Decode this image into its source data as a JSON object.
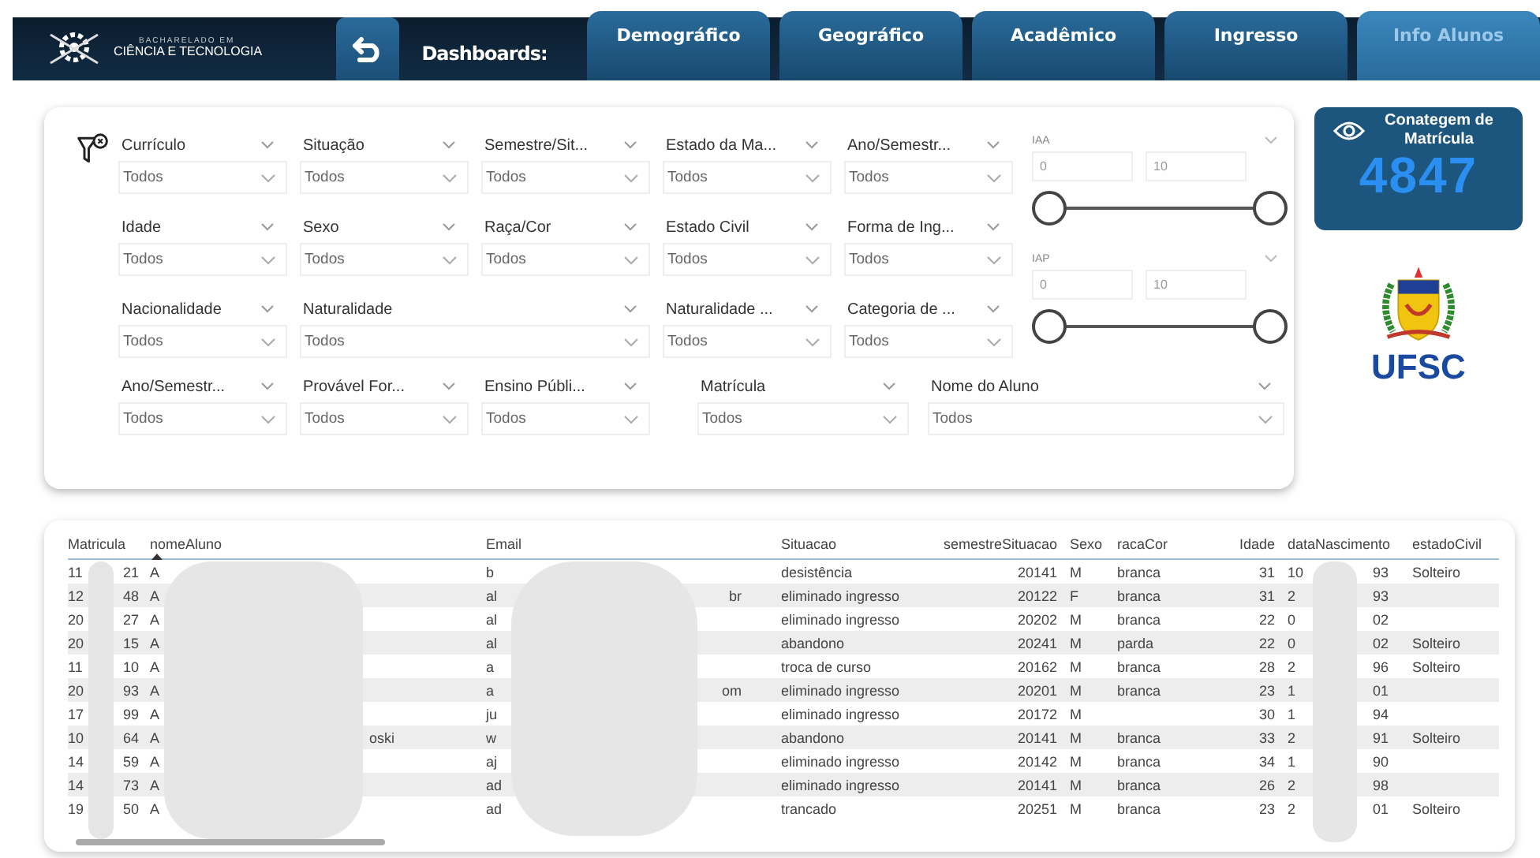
{
  "header": {
    "logo_top": "BACHARELADO EM",
    "logo_bottom": "CIÊNCIA E TECNOLOGIA",
    "nav_label": "Dashboards:",
    "tabs": [
      {
        "label": "Demográfico",
        "selected": false
      },
      {
        "label": "Geográfico",
        "selected": false
      },
      {
        "label": "Acadêmico",
        "selected": false
      },
      {
        "label": "Ingresso",
        "selected": false
      },
      {
        "label": "Info Alunos",
        "selected": true
      }
    ]
  },
  "filters": {
    "grid": [
      [
        {
          "label": "Currículo",
          "value": "Todos",
          "kind": "normal"
        },
        {
          "label": "Situação",
          "value": "Todos",
          "kind": "normal"
        },
        {
          "label": "Semestre/Sit...",
          "value": "Todos",
          "kind": "normal"
        },
        {
          "label": "Estado da Ma...",
          "value": "Todos",
          "kind": "normal"
        },
        {
          "label": "Ano/Semestr...",
          "value": "Todos",
          "kind": "normal"
        }
      ],
      [
        {
          "label": "Idade",
          "value": "Todos",
          "kind": "normal"
        },
        {
          "label": "Sexo",
          "value": "Todos",
          "kind": "normal"
        },
        {
          "label": "Raça/Cor",
          "value": "Todos",
          "kind": "normal"
        },
        {
          "label": "Estado Civil",
          "value": "Todos",
          "kind": "normal"
        },
        {
          "label": "Forma de Ing...",
          "value": "Todos",
          "kind": "normal"
        }
      ],
      [
        {
          "label": "Nacionalidade",
          "value": "Todos",
          "kind": "normal"
        },
        {
          "label": "Naturalidade",
          "value": "Todos",
          "kind": "wide"
        },
        {
          "label": "Naturalidade ...",
          "value": "Todos",
          "kind": "normal"
        },
        {
          "label": "Categoria de ...",
          "value": "Todos",
          "kind": "normal"
        }
      ]
    ],
    "bottom_row": [
      {
        "label": "Ano/Semestr...",
        "value": "Todos",
        "kind": "normal"
      },
      {
        "label": "Provável For...",
        "value": "Todos",
        "kind": "normal"
      },
      {
        "label": "Ensino Públi...",
        "value": "Todos",
        "kind": "normal"
      },
      {
        "label": "Matrícula",
        "value": "Todos",
        "kind": "medium"
      },
      {
        "label": "Nome do Aluno",
        "value": "Todos",
        "kind": "long"
      }
    ],
    "sliders": [
      {
        "label": "IAA",
        "min": "0",
        "max": "10"
      },
      {
        "label": "IAP",
        "min": "0",
        "max": "10"
      }
    ]
  },
  "card": {
    "title": "Conategem de Matrícula",
    "value": "4847"
  },
  "brand": {
    "name": "UFSC"
  },
  "table": {
    "columns": [
      "Matricula",
      "nomeAluno",
      "Email",
      "Situacao",
      "semestreSituacao",
      "Sexo",
      "racaCor",
      "Idade",
      "dataNascimento",
      "estadoCivil"
    ],
    "rows": [
      {
        "mat_start": "11",
        "mat_end": "21",
        "nome_start": "A",
        "email_start": "b",
        "situacao": "desistência",
        "semestre": "20141",
        "sexo": "M",
        "raca": "branca",
        "idade": "31",
        "nasc_start": "10",
        "nasc_end": "93",
        "estado": "Solteiro"
      },
      {
        "mat_start": "12",
        "mat_end": "48",
        "nome_start": "A",
        "email_start": "al",
        "email_end": "br",
        "situacao": "eliminado ingresso",
        "semestre": "20122",
        "sexo": "F",
        "raca": "branca",
        "idade": "31",
        "nasc_start": "2",
        "nasc_end": "93"
      },
      {
        "mat_start": "20",
        "mat_end": "27",
        "nome_start": "A",
        "email_start": "al",
        "situacao": "eliminado ingresso",
        "semestre": "20202",
        "sexo": "M",
        "raca": "branca",
        "idade": "22",
        "nasc_start": "0",
        "nasc_end": "02"
      },
      {
        "mat_start": "20",
        "mat_end": "15",
        "nome_start": "A",
        "email_start": "al",
        "situacao": "abandono",
        "semestre": "20241",
        "sexo": "M",
        "raca": "parda",
        "idade": "22",
        "nasc_start": "0",
        "nasc_end": "02",
        "estado": "Solteiro"
      },
      {
        "mat_start": "11",
        "mat_end": "10",
        "nome_start": "A",
        "email_start": "a",
        "situacao": "troca de curso",
        "semestre": "20162",
        "sexo": "M",
        "raca": "branca",
        "idade": "28",
        "nasc_start": "2",
        "nasc_end": "96",
        "estado": "Solteiro"
      },
      {
        "mat_start": "20",
        "mat_end": "93",
        "nome_start": "A",
        "email_start": "a",
        "email_end": "om",
        "situacao": "eliminado ingresso",
        "semestre": "20201",
        "sexo": "M",
        "raca": "branca",
        "idade": "23",
        "nasc_start": "1",
        "nasc_end": "01"
      },
      {
        "mat_start": "17",
        "mat_end": "99",
        "nome_start": "A",
        "email_start": "ju",
        "situacao": "eliminado ingresso",
        "semestre": "20172",
        "sexo": "M",
        "idade": "30",
        "nasc_start": "1",
        "nasc_end": "94"
      },
      {
        "mat_start": "10",
        "mat_end": "64",
        "nome_start": "A",
        "nome_end": "oski",
        "email_start": "w",
        "situacao": "abandono",
        "semestre": "20141",
        "sexo": "M",
        "raca": "branca",
        "idade": "33",
        "nasc_start": "2",
        "nasc_end": "91",
        "estado": "Solteiro"
      },
      {
        "mat_start": "14",
        "mat_end": "59",
        "nome_start": "A",
        "email_start": "aj",
        "situacao": "eliminado ingresso",
        "semestre": "20142",
        "sexo": "M",
        "raca": "branca",
        "idade": "34",
        "nasc_start": "1",
        "nasc_end": "90"
      },
      {
        "mat_start": "14",
        "mat_end": "73",
        "nome_start": "A",
        "email_start": "ad",
        "situacao": "eliminado ingresso",
        "semestre": "20141",
        "sexo": "M",
        "raca": "branca",
        "idade": "26",
        "nasc_start": "2",
        "nasc_end": "98"
      },
      {
        "mat_start": "19",
        "mat_end": "50",
        "nome_start": "A",
        "email_start": "ad",
        "situacao": "trancado",
        "semestre": "20251",
        "sexo": "M",
        "raca": "branca",
        "idade": "23",
        "nasc_start": "2",
        "nasc_end": "01",
        "estado": "Solteiro"
      }
    ]
  }
}
